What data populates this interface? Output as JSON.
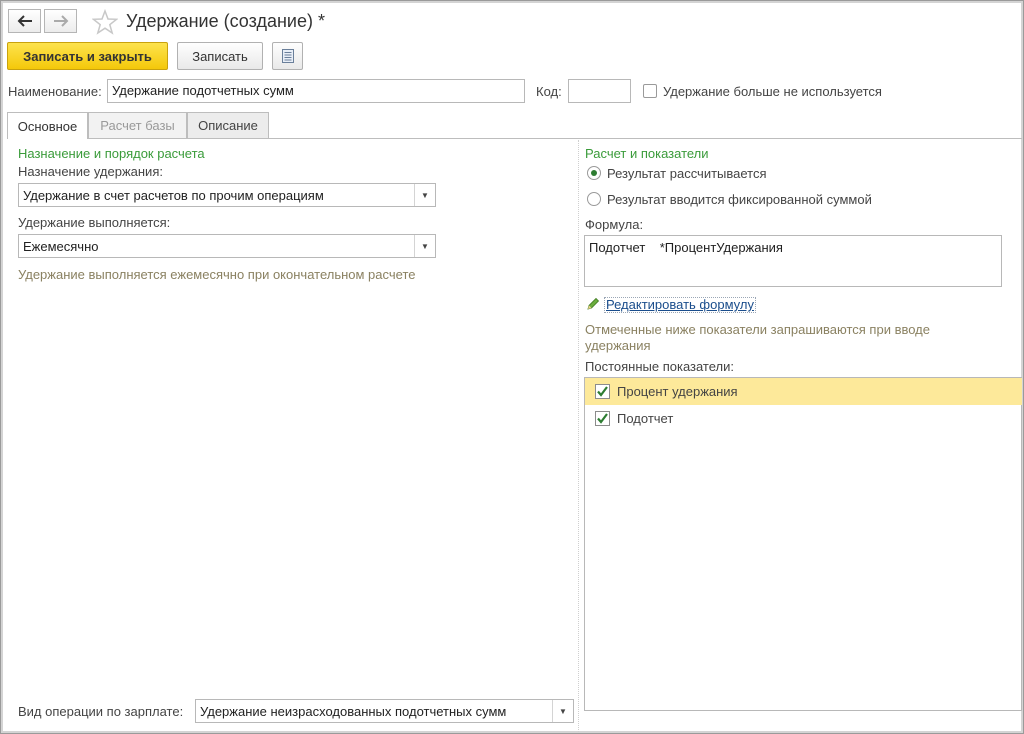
{
  "window": {
    "title": "Удержание (создание) *"
  },
  "toolbar": {
    "back_icon": "arrow-left-icon",
    "forward_icon": "arrow-right-icon",
    "favorite_icon": "star-icon",
    "save_close_label": "Записать и закрыть",
    "save_label": "Записать",
    "report_icon": "document-list-icon"
  },
  "header": {
    "name_label": "Наименование:",
    "name_value": "Удержание подотчетных сумм",
    "code_label": "Код:",
    "code_value": "",
    "unused_label": "Удержание больше не используется",
    "unused_checked": false
  },
  "tabs": [
    {
      "label": "Основное",
      "active": true
    },
    {
      "label": "Расчет базы",
      "disabled": true
    },
    {
      "label": "Описание"
    }
  ],
  "left": {
    "section_title": "Назначение и порядок расчета",
    "purpose_label": "Назначение удержания:",
    "purpose_value": "Удержание в счет расчетов по прочим операциям",
    "schedule_label": "Удержание выполняется:",
    "schedule_value": "Ежемесячно",
    "schedule_hint": "Удержание выполняется ежемесячно при окончательном расчете",
    "operation_label": "Вид операции по зарплате:",
    "operation_value": "Удержание неизрасходованных подотчетных сумм"
  },
  "right": {
    "section_title": "Расчет и показатели",
    "radio_calculated": "Результат рассчитывается",
    "radio_fixed": "Результат вводится фиксированной суммой",
    "selected_radio": "calculated",
    "formula_label": "Формула:",
    "formula_value": "Подотчет    *ПроцентУдержания",
    "edit_formula_icon": "pencil-icon",
    "edit_formula_link": "Редактировать формулу",
    "indicators_hint": "Отмеченные ниже показатели запрашиваются при вводе удержания",
    "constant_label": "Постоянные показатели:",
    "indicators": [
      {
        "label": "Процент удержания",
        "checked": true,
        "selected": true
      },
      {
        "label": "Подотчет",
        "checked": true,
        "selected": false
      }
    ]
  },
  "colors": {
    "primary_button": "#f4c80a",
    "section_title": "#3a9b3a",
    "hint_text": "#8a8161",
    "selected_row": "#fde99a",
    "link": "#1a4d8c"
  }
}
